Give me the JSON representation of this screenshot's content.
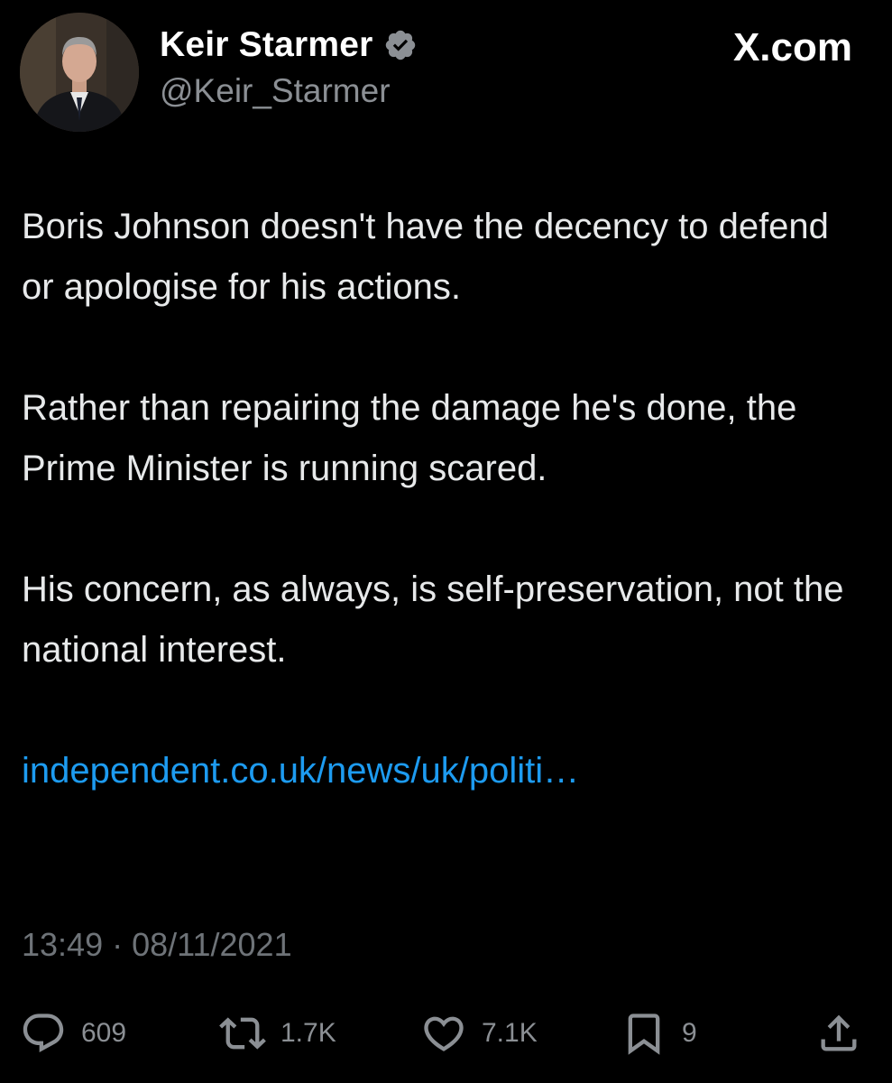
{
  "author": {
    "display_name": "Keir Starmer",
    "handle": "@Keir_Starmer",
    "verified": true,
    "verified_color": "#8b8f94"
  },
  "site_mark": "X.com",
  "tweet": {
    "paragraphs": [
      "Boris Johnson doesn't have the decency to defend or apologise for his actions.",
      "Rather than repairing the damage he's done, the Prime Minister is running scared.",
      "His concern, as always, is self-preservation, not the national interest."
    ],
    "link_text": "independent.co.uk/news/uk/politi…",
    "timestamp": "13:49 · 08/11/2021"
  },
  "actions": {
    "reply": {
      "icon": "reply-icon",
      "count": "609"
    },
    "repost": {
      "icon": "repost-icon",
      "count": "1.7K"
    },
    "like": {
      "icon": "heart-icon",
      "count": "7.1K"
    },
    "bookmark": {
      "icon": "bookmark-icon",
      "count": "9"
    },
    "share": {
      "icon": "share-icon"
    }
  },
  "colors": {
    "background": "#000000",
    "text": "#e7e9ea",
    "muted": "#8b8f94",
    "link": "#1d9bf0"
  }
}
